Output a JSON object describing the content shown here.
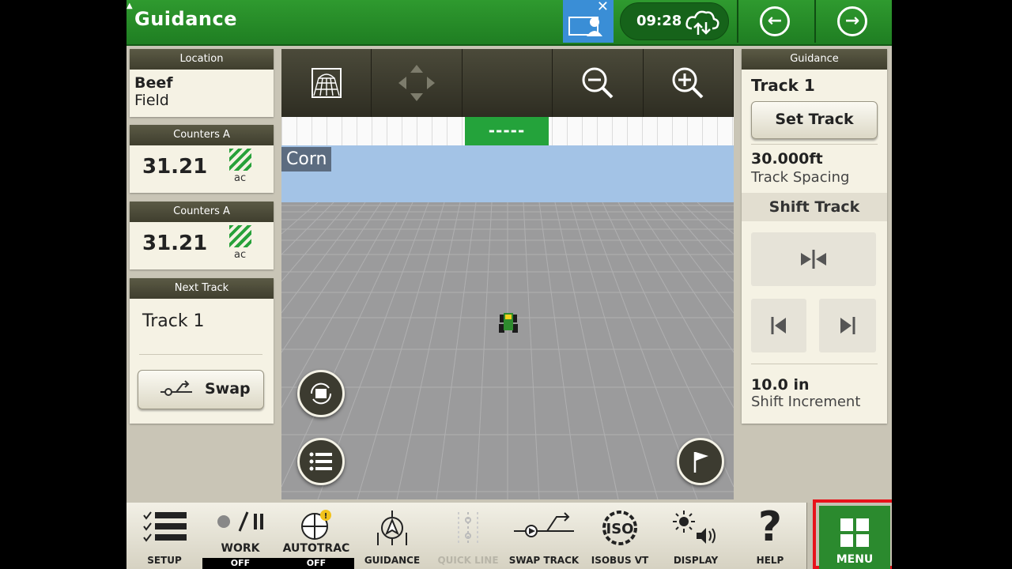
{
  "app": {
    "title": "Guidance"
  },
  "status": {
    "time": "09:28"
  },
  "left": {
    "location": {
      "header": "Location",
      "line1": "Beef",
      "line2": "Field"
    },
    "counter1": {
      "header": "Counters A",
      "value": "31.21",
      "unit": "ac"
    },
    "counter2": {
      "header": "Counters A",
      "value": "31.21",
      "unit": "ac"
    },
    "next_track": {
      "header": "Next Track",
      "value": "Track 1",
      "swap_label": "Swap"
    }
  },
  "map": {
    "crop_label": "Corn",
    "lightbar_text": "-----"
  },
  "right": {
    "header": "Guidance",
    "track_name": "Track 1",
    "set_track_label": "Set Track",
    "track_spacing_value": "30.000ft",
    "track_spacing_label": "Track Spacing",
    "shift_track_label": "Shift Track",
    "shift_increment_value": "10.0 in",
    "shift_increment_label": "Shift Increment"
  },
  "bottom": {
    "setup": "SETUP",
    "work": "WORK",
    "work_state": "OFF",
    "autotrac": "AUTOTRAC",
    "autotrac_state": "OFF",
    "guidance": "GUIDANCE",
    "quick_line": "QUICK LINE",
    "swap_track": "SWAP TRACK",
    "isobus": "ISOBUS VT",
    "display": "DISPLAY",
    "help": "HELP",
    "menu": "MENU"
  },
  "colors": {
    "accent_green": "#2f9a2f",
    "highlight_red": "#e8121a",
    "sky_blue": "#a3c3e6"
  }
}
